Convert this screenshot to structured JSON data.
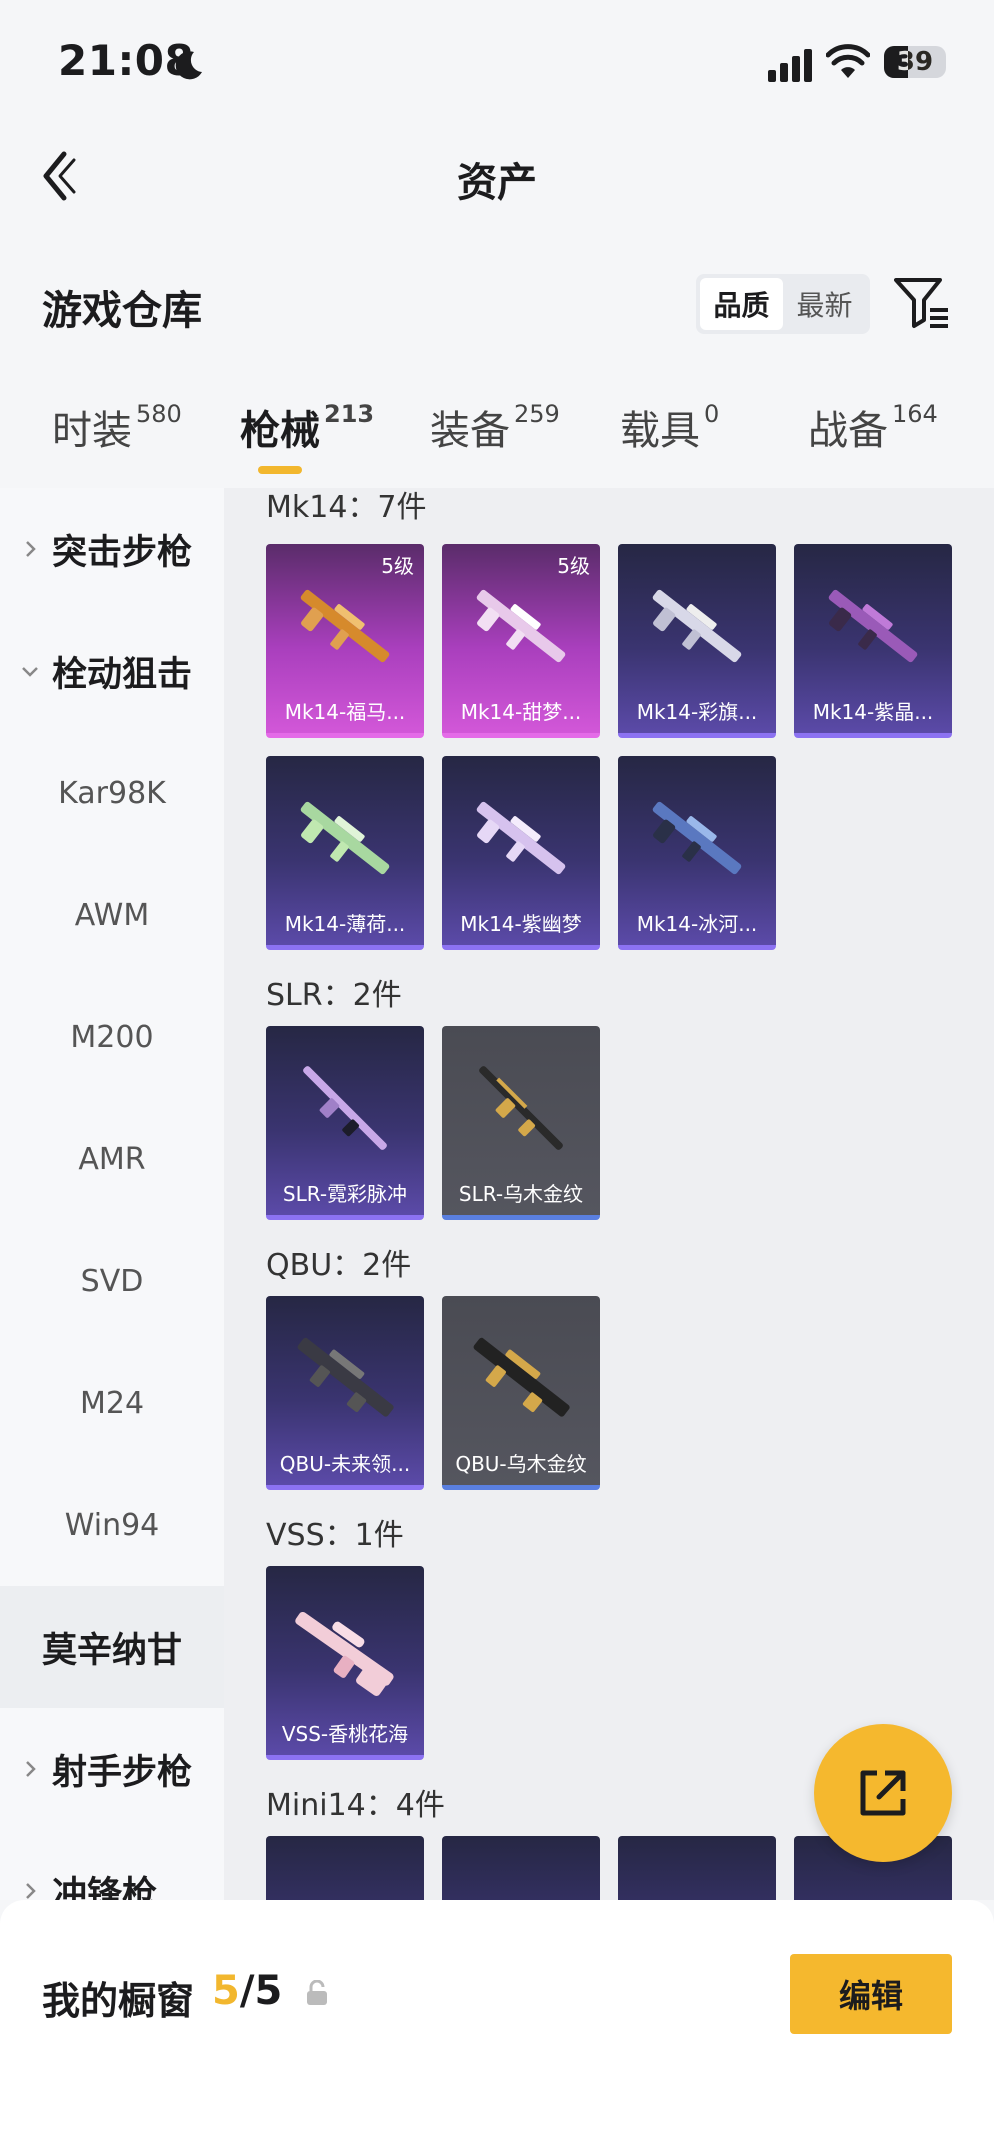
{
  "status_bar": {
    "time": "21:08",
    "battery": "39"
  },
  "header": {
    "title": "资产"
  },
  "section": {
    "title": "游戏仓库",
    "sort_options": [
      "品质",
      "最新"
    ]
  },
  "tabs": [
    {
      "label": "时装",
      "count": "580"
    },
    {
      "label": "枪械",
      "count": "213"
    },
    {
      "label": "装备",
      "count": "259"
    },
    {
      "label": "载具",
      "count": "0"
    },
    {
      "label": "战备",
      "count": "164"
    }
  ],
  "sidebar": {
    "items": [
      "突击步枪",
      "栓动狙击",
      "Kar98K",
      "AWM",
      "M200",
      "AMR",
      "SVD",
      "M24",
      "Win94",
      "莫辛纳甘",
      "射手步枪",
      "冲锋枪"
    ]
  },
  "groups": [
    {
      "title": "Mk14：7件",
      "items": [
        {
          "name": "Mk14-福马...",
          "level": "5级"
        },
        {
          "name": "Mk14-甜梦...",
          "level": "5级"
        },
        {
          "name": "Mk14-彩旗..."
        },
        {
          "name": "Mk14-紫晶..."
        },
        {
          "name": "Mk14-薄荷..."
        },
        {
          "name": "Mk14-紫幽梦"
        },
        {
          "name": "Mk14-冰河..."
        }
      ]
    },
    {
      "title": "SLR：2件",
      "items": [
        {
          "name": "SLR-霓彩脉冲"
        },
        {
          "name": "SLR-乌木金纹"
        }
      ]
    },
    {
      "title": "QBU：2件",
      "items": [
        {
          "name": "QBU-未来领..."
        },
        {
          "name": "QBU-乌木金纹"
        }
      ]
    },
    {
      "title": "VSS：1件",
      "items": [
        {
          "name": "VSS-香桃花海"
        }
      ]
    },
    {
      "title": "Mini14：4件",
      "items": []
    }
  ],
  "bottom": {
    "label": "我的橱窗",
    "count_current": "5",
    "count_total": "/5",
    "edit_label": "编辑"
  },
  "colors": {
    "accent": "#f5b82e",
    "legendary": "#d257d8",
    "epic": "#5b4aa8",
    "rare": "#55565f"
  }
}
